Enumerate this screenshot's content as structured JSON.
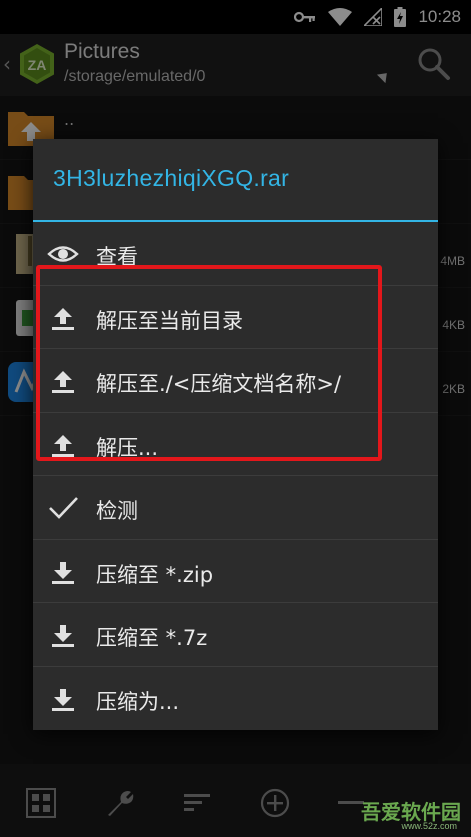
{
  "status_bar": {
    "time": "10:28",
    "icons": [
      "key-icon",
      "wifi-icon",
      "no-signal-icon",
      "battery-charging-icon"
    ]
  },
  "app_bar": {
    "title": "Pictures",
    "path": "/storage/emulated/0"
  },
  "file_list": {
    "rows": [
      {
        "name": "..",
        "size": ""
      },
      {
        "name": "",
        "size": ""
      },
      {
        "name": "",
        "size": "4MB"
      },
      {
        "name": "",
        "size": "4KB"
      },
      {
        "name": "",
        "size": "2KB"
      }
    ]
  },
  "dialog": {
    "title": "3H3luzhezhiqiXGQ.rar",
    "accent_color": "#33b5e5",
    "items": [
      {
        "label": "查看",
        "icon": "eye-icon"
      },
      {
        "label": "解压至当前目录",
        "icon": "extract-upload-icon"
      },
      {
        "label": "解压至./<压缩文档名称>/",
        "icon": "extract-upload-icon"
      },
      {
        "label": "解压...",
        "icon": "extract-upload-icon"
      },
      {
        "label": "检测",
        "icon": "check-icon"
      },
      {
        "label": "压缩至 *.zip",
        "icon": "compress-download-icon"
      },
      {
        "label": "压缩至 *.7z",
        "icon": "compress-download-icon"
      },
      {
        "label": "压缩为...",
        "icon": "compress-download-icon"
      }
    ],
    "highlight_color": "#e3171b"
  },
  "toolbar": {
    "buttons": [
      "grid-icon",
      "wrench-icon",
      "sort-icon",
      "add-icon",
      "more-icon"
    ]
  },
  "watermark": {
    "text": "吾爱软件园",
    "subtext": "www.52z.com"
  }
}
